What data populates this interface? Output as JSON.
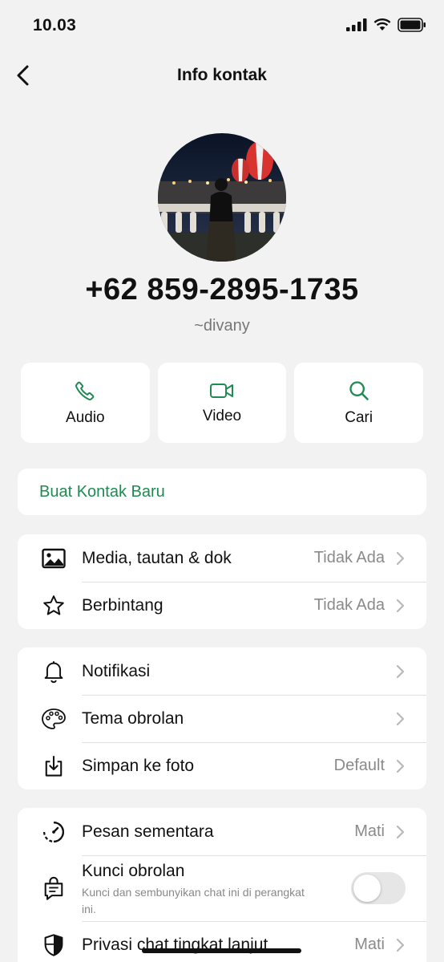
{
  "status_bar": {
    "time": "10.03"
  },
  "nav": {
    "title": "Info kontak",
    "back_icon": "chevron-left-icon"
  },
  "profile": {
    "phone": "+62 859-2895-1735",
    "username": "~divany"
  },
  "actions": [
    {
      "label": "Audio",
      "icon": "phone-icon"
    },
    {
      "label": "Video",
      "icon": "video-camera-icon"
    },
    {
      "label": "Cari",
      "icon": "search-icon"
    }
  ],
  "new_contact": {
    "label": "Buat Kontak Baru"
  },
  "group1": [
    {
      "label": "Media, tautan & dok",
      "value": "Tidak Ada",
      "icon": "image-icon"
    },
    {
      "label": "Berbintang",
      "value": "Tidak Ada",
      "icon": "star-icon"
    }
  ],
  "group2": [
    {
      "label": "Notifikasi",
      "value": "",
      "icon": "bell-icon"
    },
    {
      "label": "Tema obrolan",
      "value": "",
      "icon": "palette-icon"
    },
    {
      "label": "Simpan ke foto",
      "value": "Default",
      "icon": "download-icon"
    }
  ],
  "group3": {
    "disappearing": {
      "label": "Pesan sementara",
      "value": "Mati",
      "icon": "timer-icon"
    },
    "chat_lock": {
      "label": "Kunci obrolan",
      "sub": "Kunci dan sembunyikan chat ini di perangkat ini.",
      "enabled": false,
      "icon": "lock-chat-icon"
    },
    "privacy": {
      "label": "Privasi chat tingkat lanjut",
      "value": "Mati",
      "icon": "shield-icon"
    }
  },
  "colors": {
    "accent": "#1f8a52",
    "background": "#f2f2f2",
    "card": "#ffffff"
  }
}
